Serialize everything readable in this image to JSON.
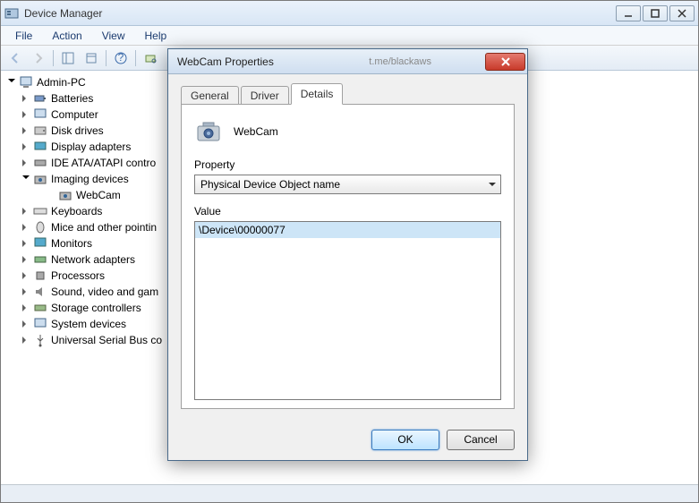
{
  "window": {
    "title": "Device Manager"
  },
  "menu": {
    "file": "File",
    "action": "Action",
    "view": "View",
    "help": "Help"
  },
  "tree": {
    "root": "Admin-PC",
    "items": [
      "Batteries",
      "Computer",
      "Disk drives",
      "Display adapters",
      "IDE ATA/ATAPI contro",
      "Imaging devices",
      "Keyboards",
      "Mice and other pointin",
      "Monitors",
      "Network adapters",
      "Processors",
      "Sound, video and gam",
      "Storage controllers",
      "System devices",
      "Universal Serial Bus co"
    ],
    "imaging_child": "WebCam"
  },
  "dialog": {
    "title": "WebCam Properties",
    "watermark": "t.me/blackaws",
    "tabs": {
      "general": "General",
      "driver": "Driver",
      "details": "Details"
    },
    "device_name": "WebCam",
    "property_label": "Property",
    "property_selected": "Physical Device Object name",
    "value_label": "Value",
    "value_row": "\\Device\\00000077",
    "ok": "OK",
    "cancel": "Cancel"
  }
}
